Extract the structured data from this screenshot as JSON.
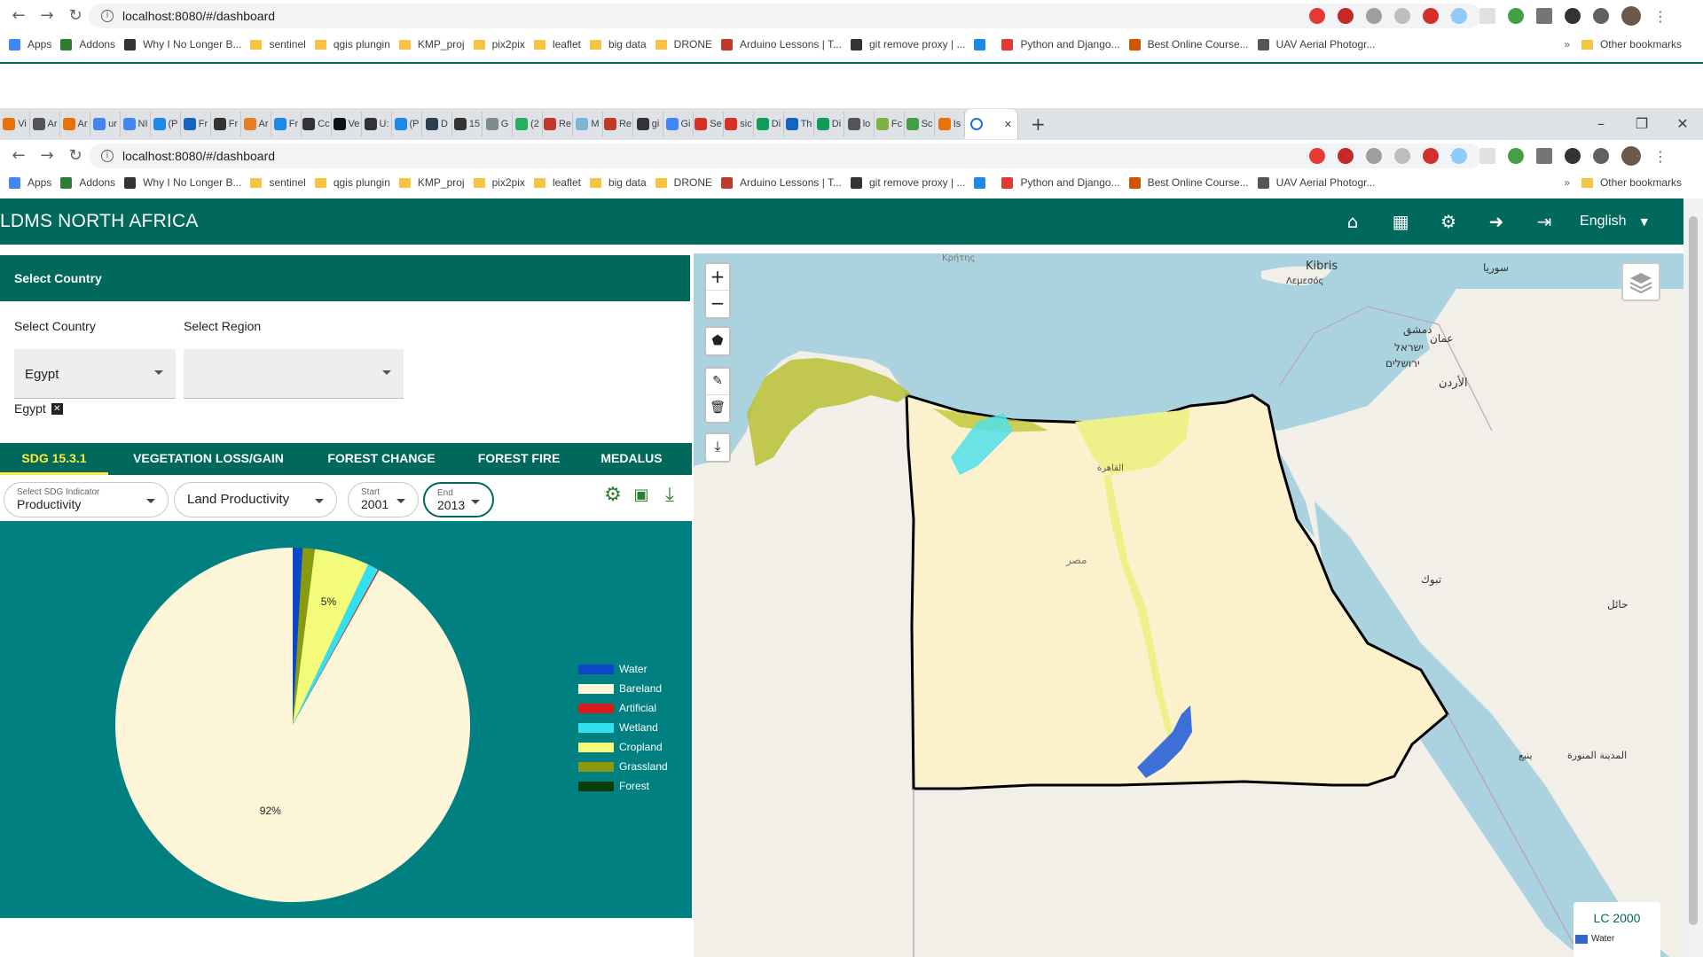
{
  "browser": {
    "url": "localhost:8080/#/dashboard",
    "bookmarks": [
      {
        "label": "Apps",
        "color": "#4285f4"
      },
      {
        "label": "Addons",
        "color": "#2e7d32"
      },
      {
        "label": "Why I No Longer B...",
        "color": "#333333"
      },
      {
        "label": "sentinel",
        "color": "#f6c342"
      },
      {
        "label": "qgis plungin",
        "color": "#f6c342"
      },
      {
        "label": "KMP_proj",
        "color": "#f6c342"
      },
      {
        "label": "pix2pix",
        "color": "#f6c342"
      },
      {
        "label": "leaflet",
        "color": "#f6c342"
      },
      {
        "label": "big data",
        "color": "#f6c342"
      },
      {
        "label": "DRONE",
        "color": "#f6c342"
      },
      {
        "label": "Arduino Lessons | T...",
        "color": "#c0392b"
      },
      {
        "label": "git remove proxy | ...",
        "color": "#333333"
      },
      {
        "label": "",
        "color": "#1e88e5"
      },
      {
        "label": "Python and Django...",
        "color": "#e53935"
      },
      {
        "label": "Best Online Course...",
        "color": "#d35400"
      },
      {
        "label": "UAV Aerial Photogr...",
        "color": "#555555"
      }
    ],
    "more": "»",
    "other_bookmarks": "Other bookmarks",
    "tabs": [
      {
        "label": "Vi",
        "color": "#e8710a"
      },
      {
        "label": "Ar",
        "color": "#555555"
      },
      {
        "label": "Ar",
        "color": "#e8710a"
      },
      {
        "label": "ur",
        "color": "#4285f4"
      },
      {
        "label": "NI",
        "color": "#4285f4"
      },
      {
        "label": "(P",
        "color": "#1e88e5"
      },
      {
        "label": "Fr",
        "color": "#1565c0"
      },
      {
        "label": "Fr",
        "color": "#333333"
      },
      {
        "label": "Ar",
        "color": "#e67e22"
      },
      {
        "label": "Fr",
        "color": "#1e88e5"
      },
      {
        "label": "Cc",
        "color": "#333333"
      },
      {
        "label": "Ve",
        "color": "#111111"
      },
      {
        "label": "U:",
        "color": "#333333"
      },
      {
        "label": "(P",
        "color": "#1e88e5"
      },
      {
        "label": "D",
        "color": "#2c3e50"
      },
      {
        "label": "15",
        "color": "#333333"
      },
      {
        "label": "G",
        "color": "#7f8c8d"
      },
      {
        "label": "(2",
        "color": "#27ae60"
      },
      {
        "label": "Re",
        "color": "#c0392b"
      },
      {
        "label": "M",
        "color": "#7fb3d5"
      },
      {
        "label": "Re",
        "color": "#c0392b"
      },
      {
        "label": "gi",
        "color": "#333333"
      },
      {
        "label": "Gi",
        "color": "#4285f4"
      },
      {
        "label": "Se",
        "color": "#d93025"
      },
      {
        "label": "sic",
        "color": "#d93025"
      },
      {
        "label": "Di",
        "color": "#0f9d58"
      },
      {
        "label": "Th",
        "color": "#1565c0"
      },
      {
        "label": "Di",
        "color": "#0f9d58"
      },
      {
        "label": "lo",
        "color": "#555555"
      },
      {
        "label": "Fc",
        "color": "#7cb342"
      },
      {
        "label": "Sc",
        "color": "#43a047"
      },
      {
        "label": "Is",
        "color": "#e8710a"
      }
    ]
  },
  "app": {
    "title": "LDMS NORTH AFRICA",
    "language": "English",
    "card_title": "Select Country",
    "country_label": "Select Country",
    "region_label": "Select Region",
    "country_value": "Egypt",
    "region_value": "",
    "chip": "Egypt",
    "chip_close": "✕",
    "tabs": [
      "SDG 15.3.1",
      "VEGETATION LOSS/GAIN",
      "FOREST CHANGE",
      "FOREST FIRE",
      "MEDALUS"
    ],
    "indicator_label": "Select SDG Indicator",
    "indicator_value": "Productivity",
    "sub_indicator": "Land Productivity",
    "start_label": "Start",
    "start_value": "2001",
    "end_label": "End",
    "end_value": "2013"
  },
  "chart_data": {
    "type": "pie",
    "slices": [
      {
        "label": "Water",
        "value": 0.9,
        "color": "#0d47c9"
      },
      {
        "label": "Forest",
        "value": 0.0,
        "color": "#0b3d0b"
      },
      {
        "label": "Grassland",
        "value": 1.1,
        "color": "#8a9a10"
      },
      {
        "label": "Cropland",
        "value": 5.0,
        "color": "#f4fa7a"
      },
      {
        "label": "Wetland",
        "value": 1.0,
        "color": "#33e0f0"
      },
      {
        "label": "Artificial",
        "value": 0.1,
        "color": "#d81b1b"
      },
      {
        "label": "Bareland",
        "value": 91.9,
        "color": "#fdf6d8"
      }
    ],
    "data_labels": [
      {
        "slice": "Cropland",
        "text": "5%"
      },
      {
        "slice": "Bareland",
        "text": "92%"
      }
    ],
    "legend": [
      "Water",
      "Bareland",
      "Artificial",
      "Wetland",
      "Cropland",
      "Grassland",
      "Forest"
    ],
    "legend_colors": [
      "#0d47c9",
      "#fdf6d8",
      "#d81b1b",
      "#33e0f0",
      "#f4fa7a",
      "#8a9a10",
      "#0b3d0b"
    ],
    "legend_position": "right"
  },
  "map": {
    "legend_title": "LC 2000",
    "legend_item": "Water",
    "zoom_in": "+",
    "zoom_out": "−",
    "labels": [
      {
        "text": "Kibris",
        "key": "kibris"
      },
      {
        "text": "Λεμεσός",
        "key": "lemesos"
      },
      {
        "text": "Κρήτης",
        "key": "kritis"
      },
      {
        "text": "ישראל",
        "key": "israel"
      },
      {
        "text": "ירושלים",
        "key": "jerusalem"
      },
      {
        "text": "عمان",
        "key": "amman"
      },
      {
        "text": "الأردن",
        "key": "jordan"
      },
      {
        "text": "تبوك",
        "key": "tabuk"
      },
      {
        "text": "مصر",
        "key": "egypt"
      },
      {
        "text": "القاهرة",
        "key": "cairo"
      },
      {
        "text": "حائل",
        "key": "hail"
      },
      {
        "text": "المدينة المنورة",
        "key": "madinah"
      },
      {
        "text": "ينبع",
        "key": "yanbu"
      },
      {
        "text": "سوريا",
        "key": "syria"
      },
      {
        "text": "دمشق",
        "key": "damascus"
      }
    ]
  },
  "colors": {
    "brand": "#00695c",
    "tab_active": "#ffeb3b",
    "sea": "#aad3df",
    "border": "#000000"
  }
}
